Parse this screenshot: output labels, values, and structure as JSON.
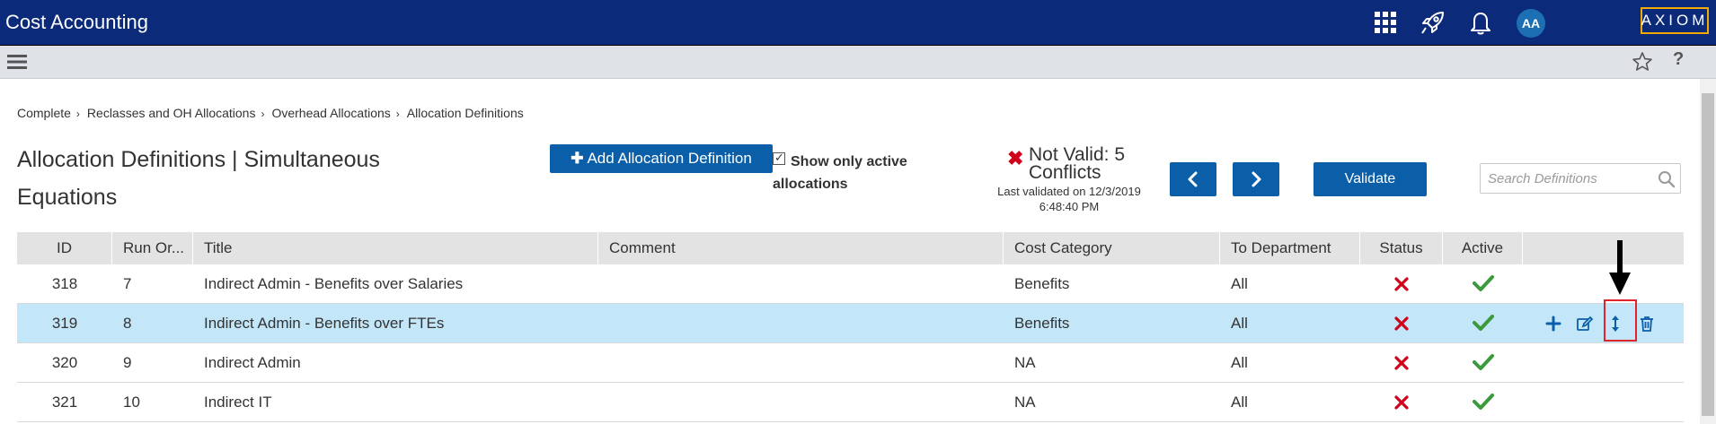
{
  "app": {
    "title": "Cost Accounting",
    "logo_text": "AXIOM",
    "user_initials": "AA"
  },
  "header_icons": [
    "apps-grid-icon",
    "rocket-icon",
    "bell-icon"
  ],
  "toolbar_icons": [
    "hamburger-menu-icon",
    "star-icon",
    "help-icon"
  ],
  "breadcrumb": [
    "Complete",
    "Reclasses and OH Allocations",
    "Overhead Allocations",
    "Allocation Definitions"
  ],
  "page": {
    "title": "Allocation Definitions | Simultaneous Equations",
    "add_button": "Add Allocation Definition",
    "show_active_label": "Show only active allocations",
    "show_active_checked": true,
    "validation_status": "Not Valid: 5 Conflicts",
    "last_validated": "Last validated on 12/3/2019 6:48:40 PM",
    "validate_button": "Validate",
    "search_placeholder": "Search Definitions"
  },
  "table": {
    "columns": [
      "ID",
      "Run Or...",
      "Title",
      "Comment",
      "Cost Category",
      "To Department",
      "Status",
      "Active",
      ""
    ],
    "rows": [
      {
        "id": "318",
        "run_order": "7",
        "title": "Indirect Admin - Benefits over Salaries",
        "comment": "",
        "cost_category": "Benefits",
        "to_department": "All",
        "status": "invalid",
        "active": true,
        "selected": false
      },
      {
        "id": "319",
        "run_order": "8",
        "title": "Indirect Admin - Benefits over FTEs",
        "comment": "",
        "cost_category": "Benefits",
        "to_department": "All",
        "status": "invalid",
        "active": true,
        "selected": true
      },
      {
        "id": "320",
        "run_order": "9",
        "title": "Indirect Admin",
        "comment": "",
        "cost_category": "NA",
        "to_department": "All",
        "status": "invalid",
        "active": true,
        "selected": false
      },
      {
        "id": "321",
        "run_order": "10",
        "title": "Indirect IT",
        "comment": "",
        "cost_category": "NA",
        "to_department": "All",
        "status": "invalid",
        "active": true,
        "selected": false
      }
    ],
    "row_action_icons": [
      "plus-icon",
      "edit-icon",
      "reorder-icon",
      "trash-icon"
    ]
  },
  "colors": {
    "header_bg": "#0c2a7a",
    "accent": "#0b5ea8",
    "selected_row": "#c3e6f9",
    "invalid": "#d0021b",
    "valid": "#3c9a3c",
    "logo_border": "#f2a900",
    "callout": "#e0242c"
  }
}
